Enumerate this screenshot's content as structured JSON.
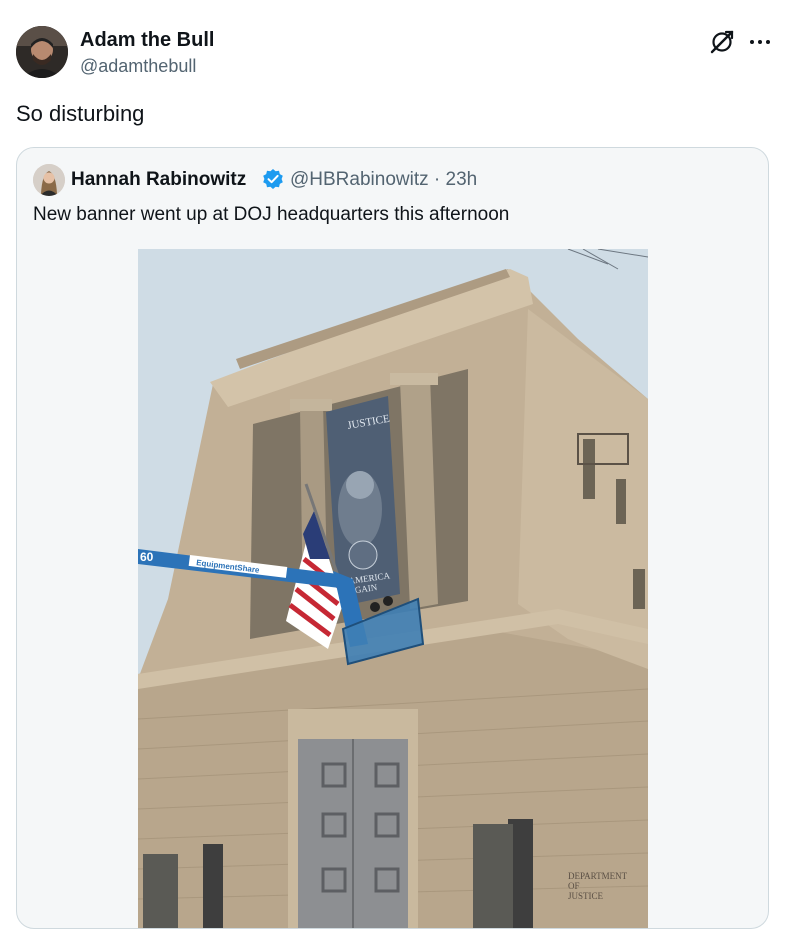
{
  "tweet": {
    "author": {
      "name": "Adam the Bull",
      "handle": "@adamthebull",
      "avatar_icon": "profile-photo"
    },
    "text": "So disturbing",
    "actions": {
      "grok_icon": "grok-icon",
      "more_icon": "more-dots-icon"
    }
  },
  "quoted_tweet": {
    "author": {
      "name": "Hannah Rabinowitz",
      "handle": "@HBRabinowitz",
      "verified": true,
      "avatar_icon": "profile-photo"
    },
    "meta": "@HBRabinowitz · 23h",
    "text": "New banner went up at DOJ headquarters this afternoon",
    "photo": {
      "banner_text_top": "JUSTICE",
      "banner_text_bottom": "E AMERICA\nEAGAIN",
      "lift_text": "60",
      "lift_brand": "EquipmentShare",
      "plaque_text": "DEPARTMENT\nOF\nJUSTICE"
    }
  },
  "colors": {
    "text": "#0f1419",
    "secondary": "#536471",
    "border": "#cfd9de",
    "verified": "#1d9bf0",
    "lift": "#2c73b8"
  }
}
